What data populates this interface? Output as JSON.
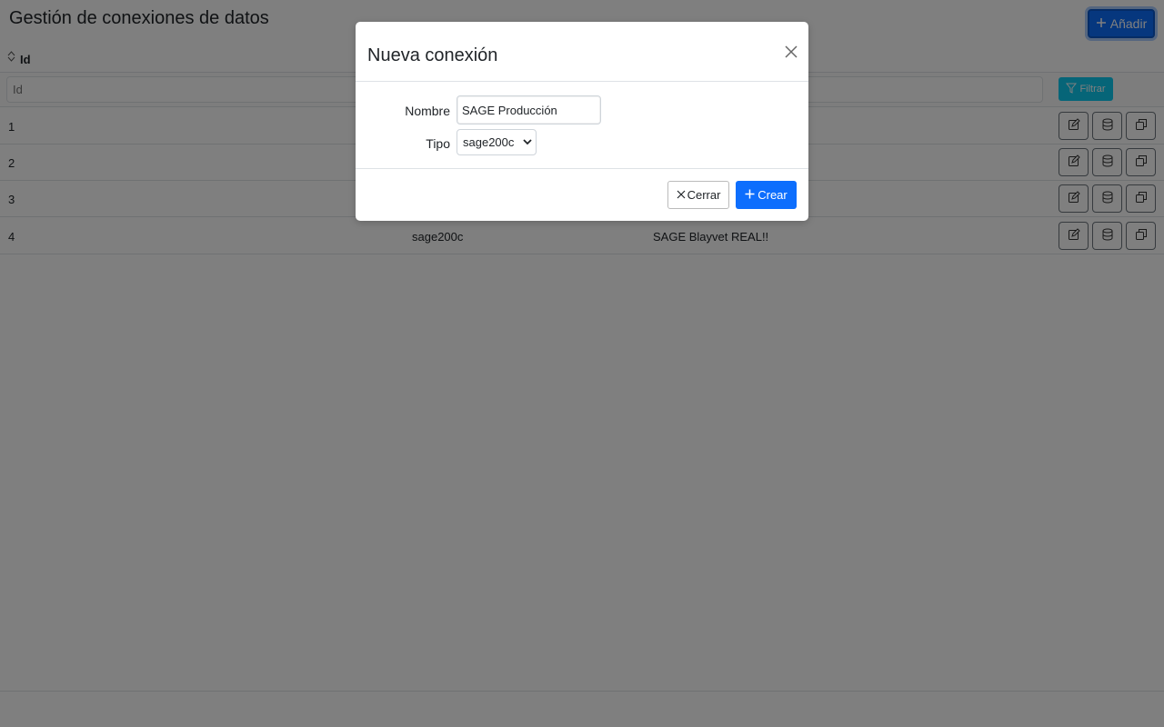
{
  "page": {
    "title": "Gestión de conexiones de datos",
    "add_button_label": "Añadir",
    "add_icon": "plus-icon"
  },
  "table": {
    "columns": [
      "Id"
    ],
    "filter": {
      "placeholder": "Id",
      "button_label": "Filtrar",
      "button_icon": "funnel-icon"
    },
    "rows": [
      {
        "id": "1",
        "type": "",
        "name": ""
      },
      {
        "id": "2",
        "type": "",
        "name": ""
      },
      {
        "id": "3",
        "type": "",
        "name": ""
      },
      {
        "id": "4",
        "type": "sage200c",
        "name": "SAGE Blayvet REAL!!"
      }
    ],
    "row_actions": [
      "edit-icon",
      "database-icon",
      "copy-icon"
    ]
  },
  "modal": {
    "title": "Nueva conexión",
    "close_icon": "close-icon",
    "fields": {
      "nombre_label": "Nombre",
      "nombre_value": "SAGE Producción",
      "tipo_label": "Tipo",
      "tipo_value": "sage200c"
    },
    "footer": {
      "close_label": "Cerrar",
      "create_label": "Crear"
    }
  },
  "colors": {
    "primary": "#0d6efd",
    "info": "#0dcaf0",
    "backdrop": "rgba(0,0,0,0.5)"
  }
}
